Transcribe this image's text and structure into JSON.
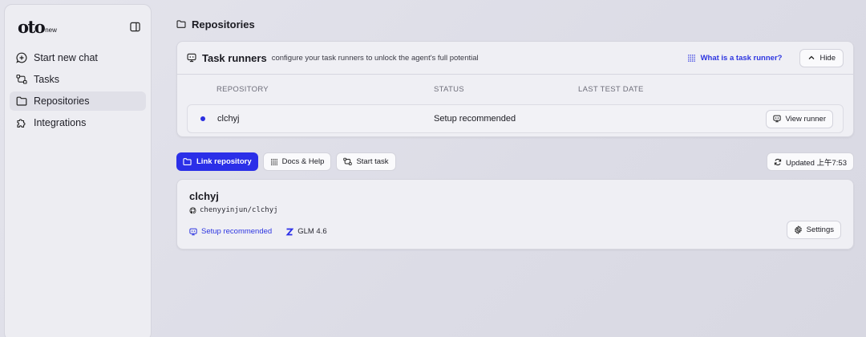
{
  "sidebar": {
    "logo_main": "oto",
    "logo_sub": "new",
    "items": [
      {
        "label": "Start new chat"
      },
      {
        "label": "Tasks"
      },
      {
        "label": "Repositories"
      },
      {
        "label": "Integrations"
      }
    ]
  },
  "page": {
    "title": "Repositories"
  },
  "task_runners": {
    "title": "Task runners",
    "subtitle": "configure your task runners to unlock the agent's full potential",
    "help_link": "What is a task runner?",
    "hide_label": "Hide",
    "columns": [
      "REPOSITORY",
      "STATUS",
      "LAST TEST DATE"
    ],
    "rows": [
      {
        "repository": "clchyj",
        "status": "Setup recommended",
        "last_test_date": "",
        "action": "View runner"
      }
    ]
  },
  "toolbar": {
    "link_repository": "Link repository",
    "docs_help": "Docs & Help",
    "start_task": "Start task",
    "updated": "Updated 上午7:53"
  },
  "repo_card": {
    "name": "clchyj",
    "path": "chenyyinjun/clchyj",
    "status_link": "Setup recommended",
    "model": "GLM 4.6",
    "settings_label": "Settings"
  },
  "colors": {
    "accent": "#2b2fe8",
    "link": "#2d35e0"
  }
}
